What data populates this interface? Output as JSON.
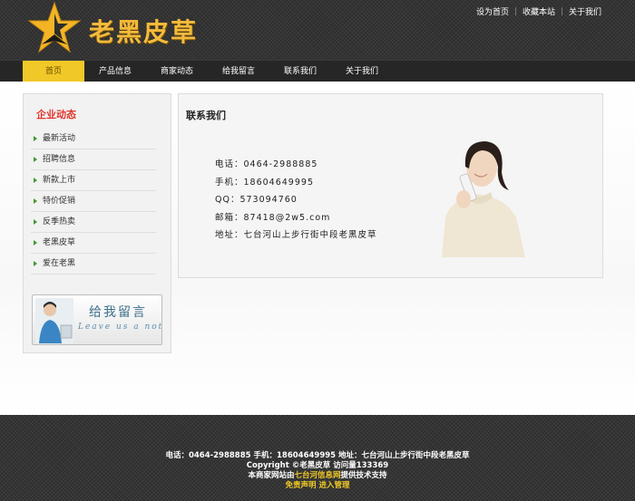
{
  "header": {
    "logo_text": "老黑皮草",
    "top_links": [
      "设为首页",
      "收藏本站",
      "关于我们"
    ]
  },
  "nav": {
    "items": [
      "首页",
      "产品信息",
      "商家动态",
      "给我留言",
      "联系我们",
      "关于我们"
    ],
    "active_index": 0
  },
  "sidebar": {
    "title": "企业动态",
    "items": [
      "最新活动",
      "招聘信息",
      "新款上市",
      "特价促销",
      "反季热卖",
      "老黑皮草",
      "爱在老黑"
    ],
    "banner": {
      "title": "给我留言",
      "subtitle": "Leave us a not"
    }
  },
  "content": {
    "title": "联系我们",
    "lines": [
      "电话：0464-2988885",
      "手机：18604649995",
      "QQ：573094760",
      "邮箱：87418@2w5.com",
      "地址：七台河山上步行街中段老黑皮草"
    ]
  },
  "footer": {
    "line1": "电话：0464-2988885 手机：18604649995 地址：七台河山上步行街中段老黑皮草",
    "line2": "Copyright ©老黑皮草 访问量133369",
    "line3_prefix": "本商家网站由",
    "line3_link": "七台河信息网",
    "line3_suffix": "提供技术支持",
    "disclaimer_link": "免责声明",
    "admin_link": "进入管理"
  },
  "colors": {
    "accent_yellow": "#f0c928",
    "logo_gold": "#f3ba3c",
    "sidebar_title_red": "#e0342a",
    "bullet_green": "#3e9a2c",
    "header_bg": "#2d2d2d"
  }
}
